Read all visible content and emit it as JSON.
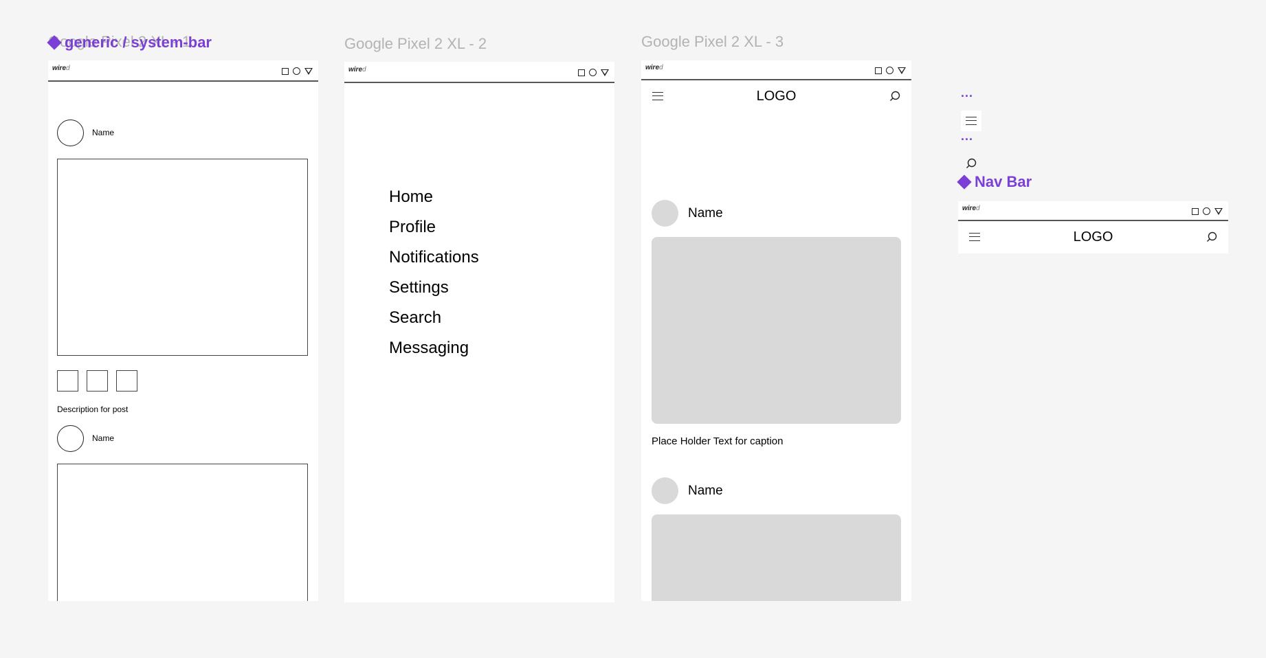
{
  "frames": {
    "frame1_title": "Google Pixel 2 XL - 1",
    "frame2_title": "Google Pixel 2 XL - 2",
    "frame3_title": "Google Pixel 2 XL - 3"
  },
  "components": {
    "system_bar_title": "generic / system-bar",
    "nav_bar_title": "Nav Bar",
    "dots": "..."
  },
  "system_bar": {
    "brand_bold": "wire",
    "brand_light": "d",
    "icons": [
      "square-icon",
      "circle-icon",
      "triangle-icon"
    ]
  },
  "frame1": {
    "post1_name": "Name",
    "description": "Description for post",
    "post2_name": "Name"
  },
  "frame2": {
    "menu": [
      "Home",
      "Profile",
      "Notifications",
      "Settings",
      "Search",
      "Messaging"
    ]
  },
  "nav_bar": {
    "logo": "LOGO"
  },
  "frame3": {
    "post1_name": "Name",
    "caption": "Place Holder Text for caption",
    "post2_name": "Name"
  },
  "colors": {
    "canvas": "#f5f5f5",
    "component_purple": "#7b3fd6",
    "frame_title_gray": "#b3b3b3",
    "placeholder_gray": "#d9d9d9"
  }
}
